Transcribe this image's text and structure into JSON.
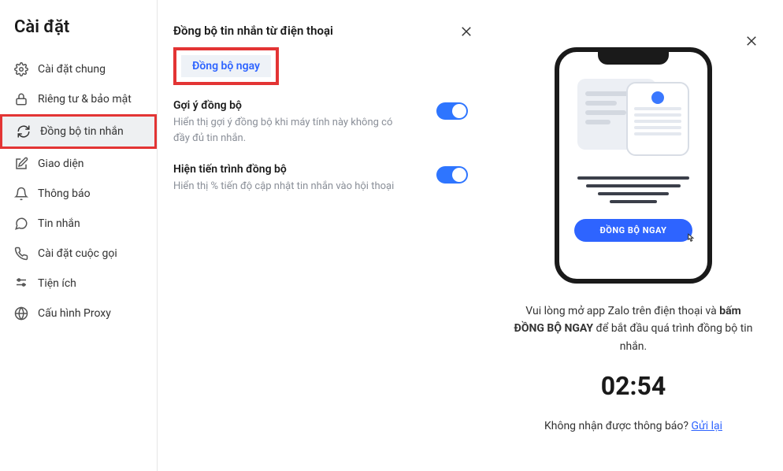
{
  "sidebar": {
    "title": "Cài đặt",
    "items": [
      {
        "label": "Cài đặt chung"
      },
      {
        "label": "Riêng tư & bảo mật"
      },
      {
        "label": "Đồng bộ tin nhắn"
      },
      {
        "label": "Giao diện"
      },
      {
        "label": "Thông báo"
      },
      {
        "label": "Tin nhắn"
      },
      {
        "label": "Cài đặt cuộc gọi"
      },
      {
        "label": "Tiện ích"
      },
      {
        "label": "Cấu hình Proxy"
      }
    ]
  },
  "main": {
    "section_title": "Đồng bộ tin nhắn từ điện thoại",
    "sync_now": "Đồng bộ ngay",
    "settings": [
      {
        "label": "Gợi ý đồng bộ",
        "desc": "Hiển thị gợi ý đồng bộ khi máy tính này không có đầy đủ tin nhắn."
      },
      {
        "label": "Hiện tiến trình đồng bộ",
        "desc": "Hiển thị % tiến độ cập nhật tin nhắn vào hội thoại"
      }
    ]
  },
  "right": {
    "phone_cta": "ĐỒNG BỘ NGAY",
    "instruction_pre": "Vui lòng mở app Zalo trên điện thoại và ",
    "instruction_bold_prefix": "bấm ",
    "instruction_bold": "ĐỒNG BỘ NGAY",
    "instruction_post": " để bắt đầu quá trình đồng bộ tin nhắn.",
    "timer": "02:54",
    "resend_prompt": "Không nhận được thông báo? ",
    "resend_link": "Gửi lại"
  }
}
